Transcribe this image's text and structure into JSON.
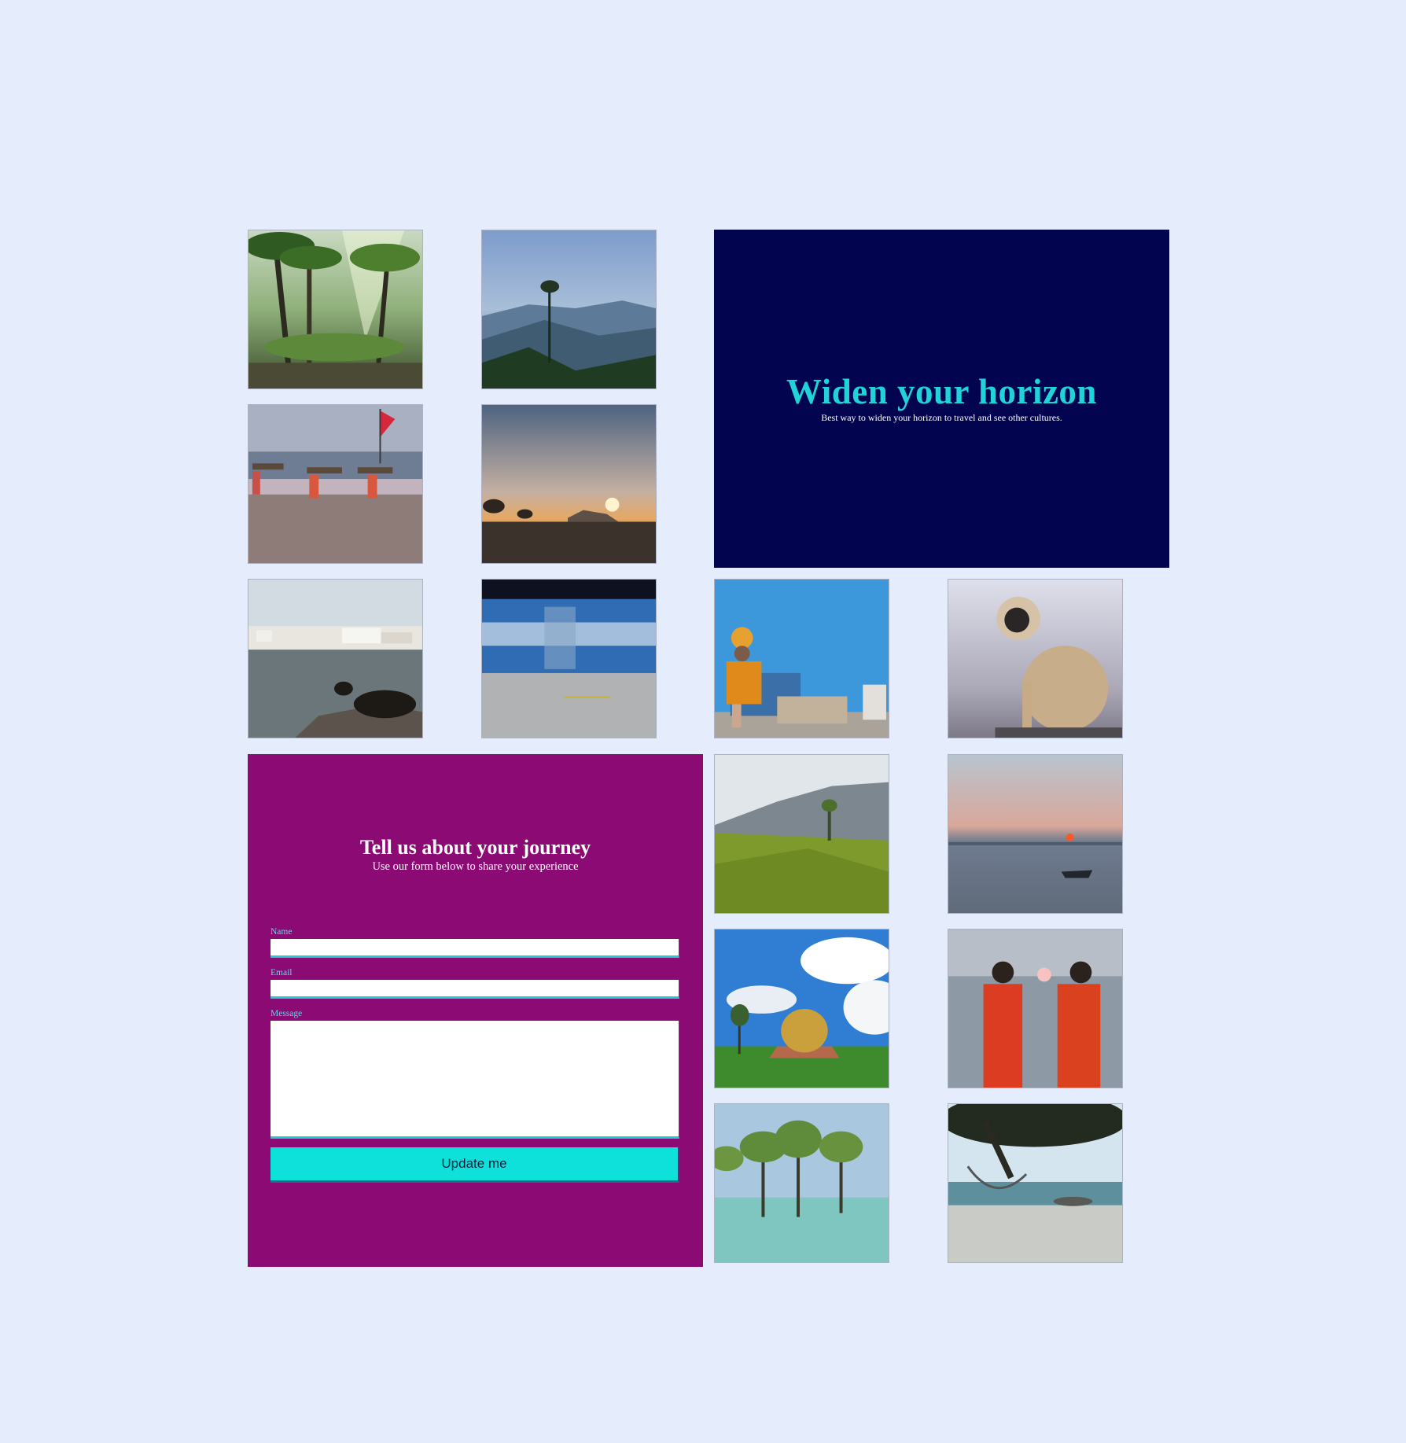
{
  "hero": {
    "title": "Widen your horizon",
    "subtitle": "Best way to widen your horizon to travel and see other cultures."
  },
  "form": {
    "title": "Tell us about your journey",
    "subtitle": "Use our form below to share your experience",
    "name_label": "Name",
    "name_value": "",
    "email_label": "Email",
    "email_value": "",
    "message_label": "Message",
    "message_value": "",
    "submit_label": "Update me"
  },
  "colors": {
    "page_background": "#e5edfd",
    "hero_background": "#020450",
    "hero_title": "#1fd3d9",
    "form_background": "#8c0a74",
    "form_label": "#63d5e6",
    "button_background": "#0ee1d9"
  }
}
